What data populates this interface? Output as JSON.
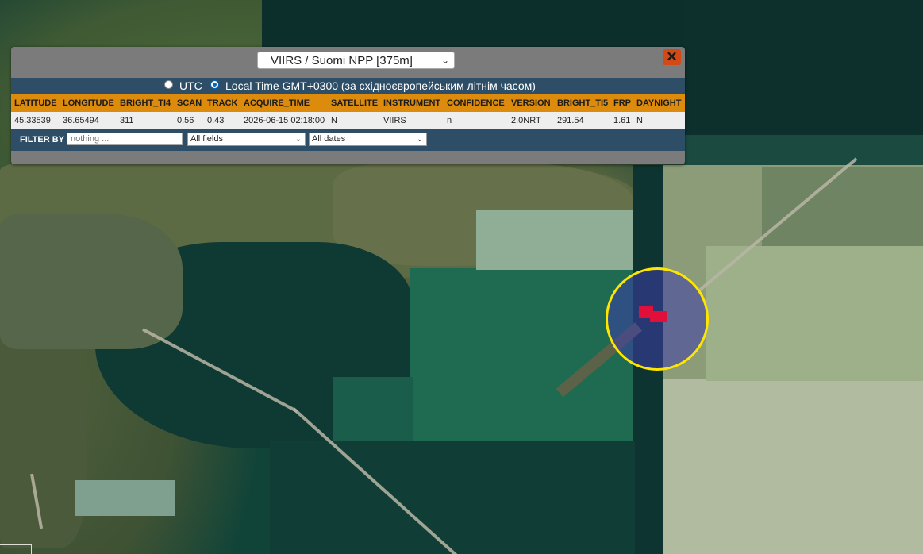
{
  "source_select": {
    "value": "VIIRS / Suomi NPP [375m]"
  },
  "close_label": "✕",
  "time_options": {
    "utc_label": "UTC",
    "local_label": "Local Time GMT+0300 (за східноєвропейським літнім часом)",
    "selected": "local"
  },
  "table": {
    "headers": [
      "LATITUDE",
      "LONGITUDE",
      "BRIGHT_TI4",
      "SCAN",
      "TRACK",
      "ACQUIRE_TIME",
      "SATELLITE",
      "INSTRUMENT",
      "CONFIDENCE",
      "VERSION",
      "BRIGHT_TI5",
      "FRP",
      "DAYNIGHT"
    ],
    "rows": [
      [
        "45.33539",
        "36.65494",
        "311",
        "0.56",
        "0.43",
        "2026-06-15 02:18:00",
        "N",
        "VIIRS",
        "n",
        "2.0NRT",
        "291.54",
        "1.61",
        "N"
      ]
    ]
  },
  "filter": {
    "label": "FILTER BY",
    "placeholder": "nothing ...",
    "field_select": "All fields",
    "date_select": "All dates"
  },
  "colors": {
    "panel_bg": "#7b7b7b",
    "bar_blue": "#2d4e66",
    "header_orange": "#dc8b0c",
    "close_orange": "#d34a16",
    "marker_ring": "#ffe600",
    "fire_red": "#e0103a"
  },
  "icons": {
    "close": "close-icon",
    "dropdown": "chevron-down-icon"
  }
}
